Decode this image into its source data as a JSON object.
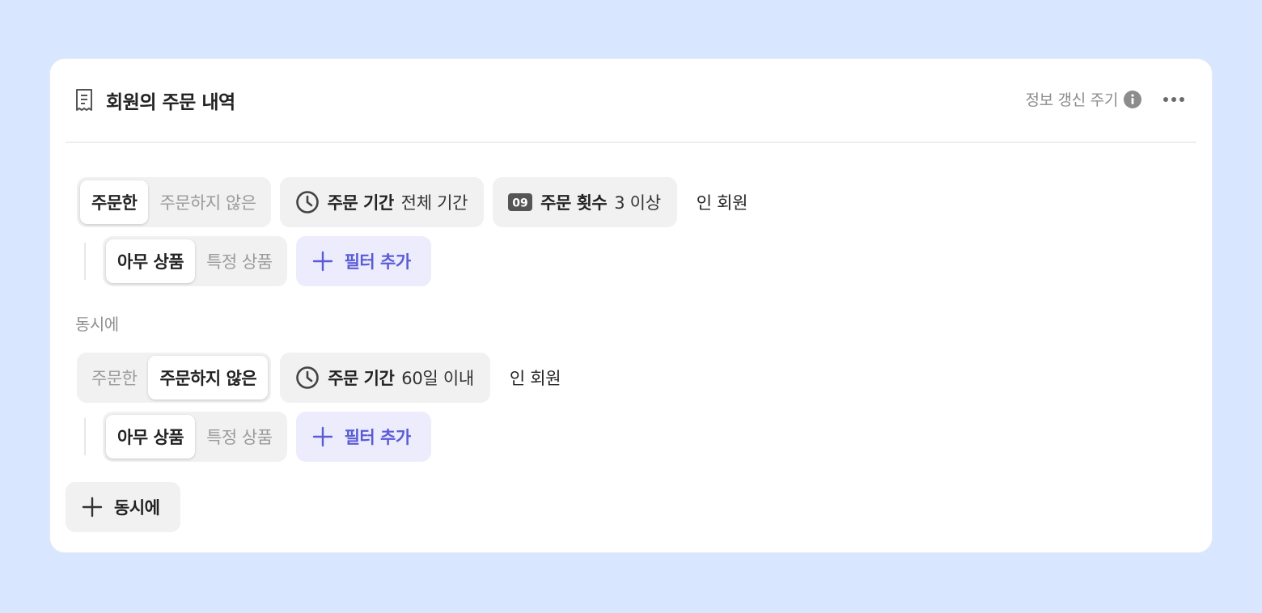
{
  "header": {
    "title": "회원의 주문 내역",
    "title_icon": "receipt-icon",
    "refresh_label": "정보 갱신 주기",
    "info_icon": "info-icon",
    "more_icon": "more-horizontal-icon"
  },
  "group1": {
    "order_toggle": {
      "options": [
        "주문한",
        "주문하지 않은"
      ],
      "selected": "주문한"
    },
    "period_chip": {
      "icon": "clock-icon",
      "label": "주문 기간",
      "value": "전체 기간"
    },
    "count_chip": {
      "icon": "number-badge-icon",
      "badge": "09",
      "label": "주문 횟수",
      "value": "3 이상"
    },
    "suffix": "인 회원",
    "product_toggle": {
      "options": [
        "아무 상품",
        "특정 상품"
      ],
      "selected": "아무 상품"
    },
    "add_filter_label": "필터 추가"
  },
  "and_label": "동시에",
  "group2": {
    "order_toggle": {
      "options": [
        "주문한",
        "주문하지 않은"
      ],
      "selected": "주문하지 않은"
    },
    "period_chip": {
      "icon": "clock-icon",
      "label": "주문 기간",
      "value": "60일 이내"
    },
    "suffix": "인 회원",
    "product_toggle": {
      "options": [
        "아무 상품",
        "특정 상품"
      ],
      "selected": "아무 상품"
    },
    "add_filter_label": "필터 추가"
  },
  "add_and_label": "동시에",
  "colors": {
    "background": "#d9e6ff",
    "accent": "#5b5bd6",
    "accent_bg": "#ececfd",
    "chip_bg": "#f1f1f1"
  }
}
